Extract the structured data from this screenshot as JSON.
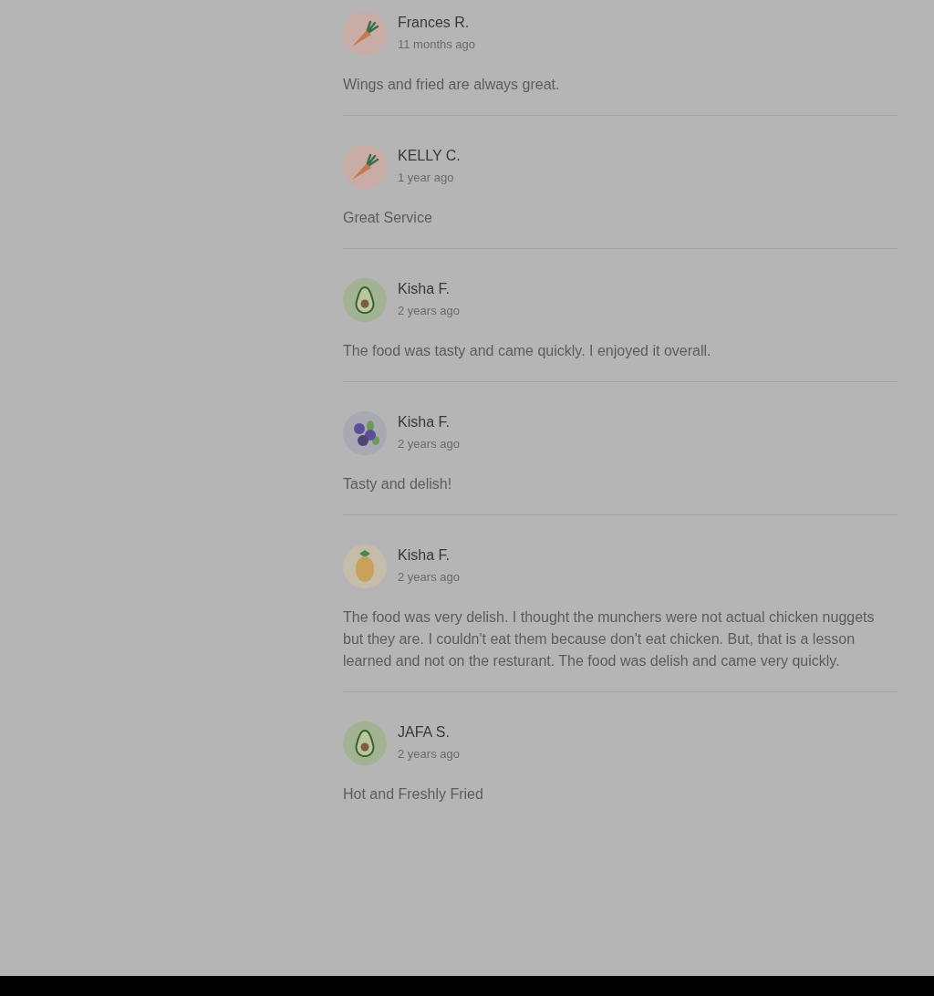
{
  "reviews": [
    {
      "avatar": {
        "kind": "carrot"
      },
      "name": "Frances R.",
      "date": "11 months ago",
      "text": "Wings and fried are always great."
    },
    {
      "avatar": {
        "kind": "carrot"
      },
      "name": "KELLY C.",
      "date": "1 year ago",
      "text": "Great Service"
    },
    {
      "avatar": {
        "kind": "avocado"
      },
      "name": "Kisha F.",
      "date": "2 years ago",
      "text": "The food was tasty and came quickly. I enjoyed it overall."
    },
    {
      "avatar": {
        "kind": "blueberry"
      },
      "name": "Kisha F.",
      "date": "2 years ago",
      "text": "Tasty and delish!"
    },
    {
      "avatar": {
        "kind": "pineapple"
      },
      "name": "Kisha F.",
      "date": "2 years ago",
      "text": "The food was very delish. I thought the munchers were not actual chicken nuggets but they are. I couldn't eat them because don't eat chicken. But, that is a lesson learned and not on the resturant. The food was delish and came very quickly."
    },
    {
      "avatar": {
        "kind": "avocado"
      },
      "name": "JAFA S.",
      "date": "2 years ago",
      "text": "Hot and Freshly Fried"
    }
  ]
}
